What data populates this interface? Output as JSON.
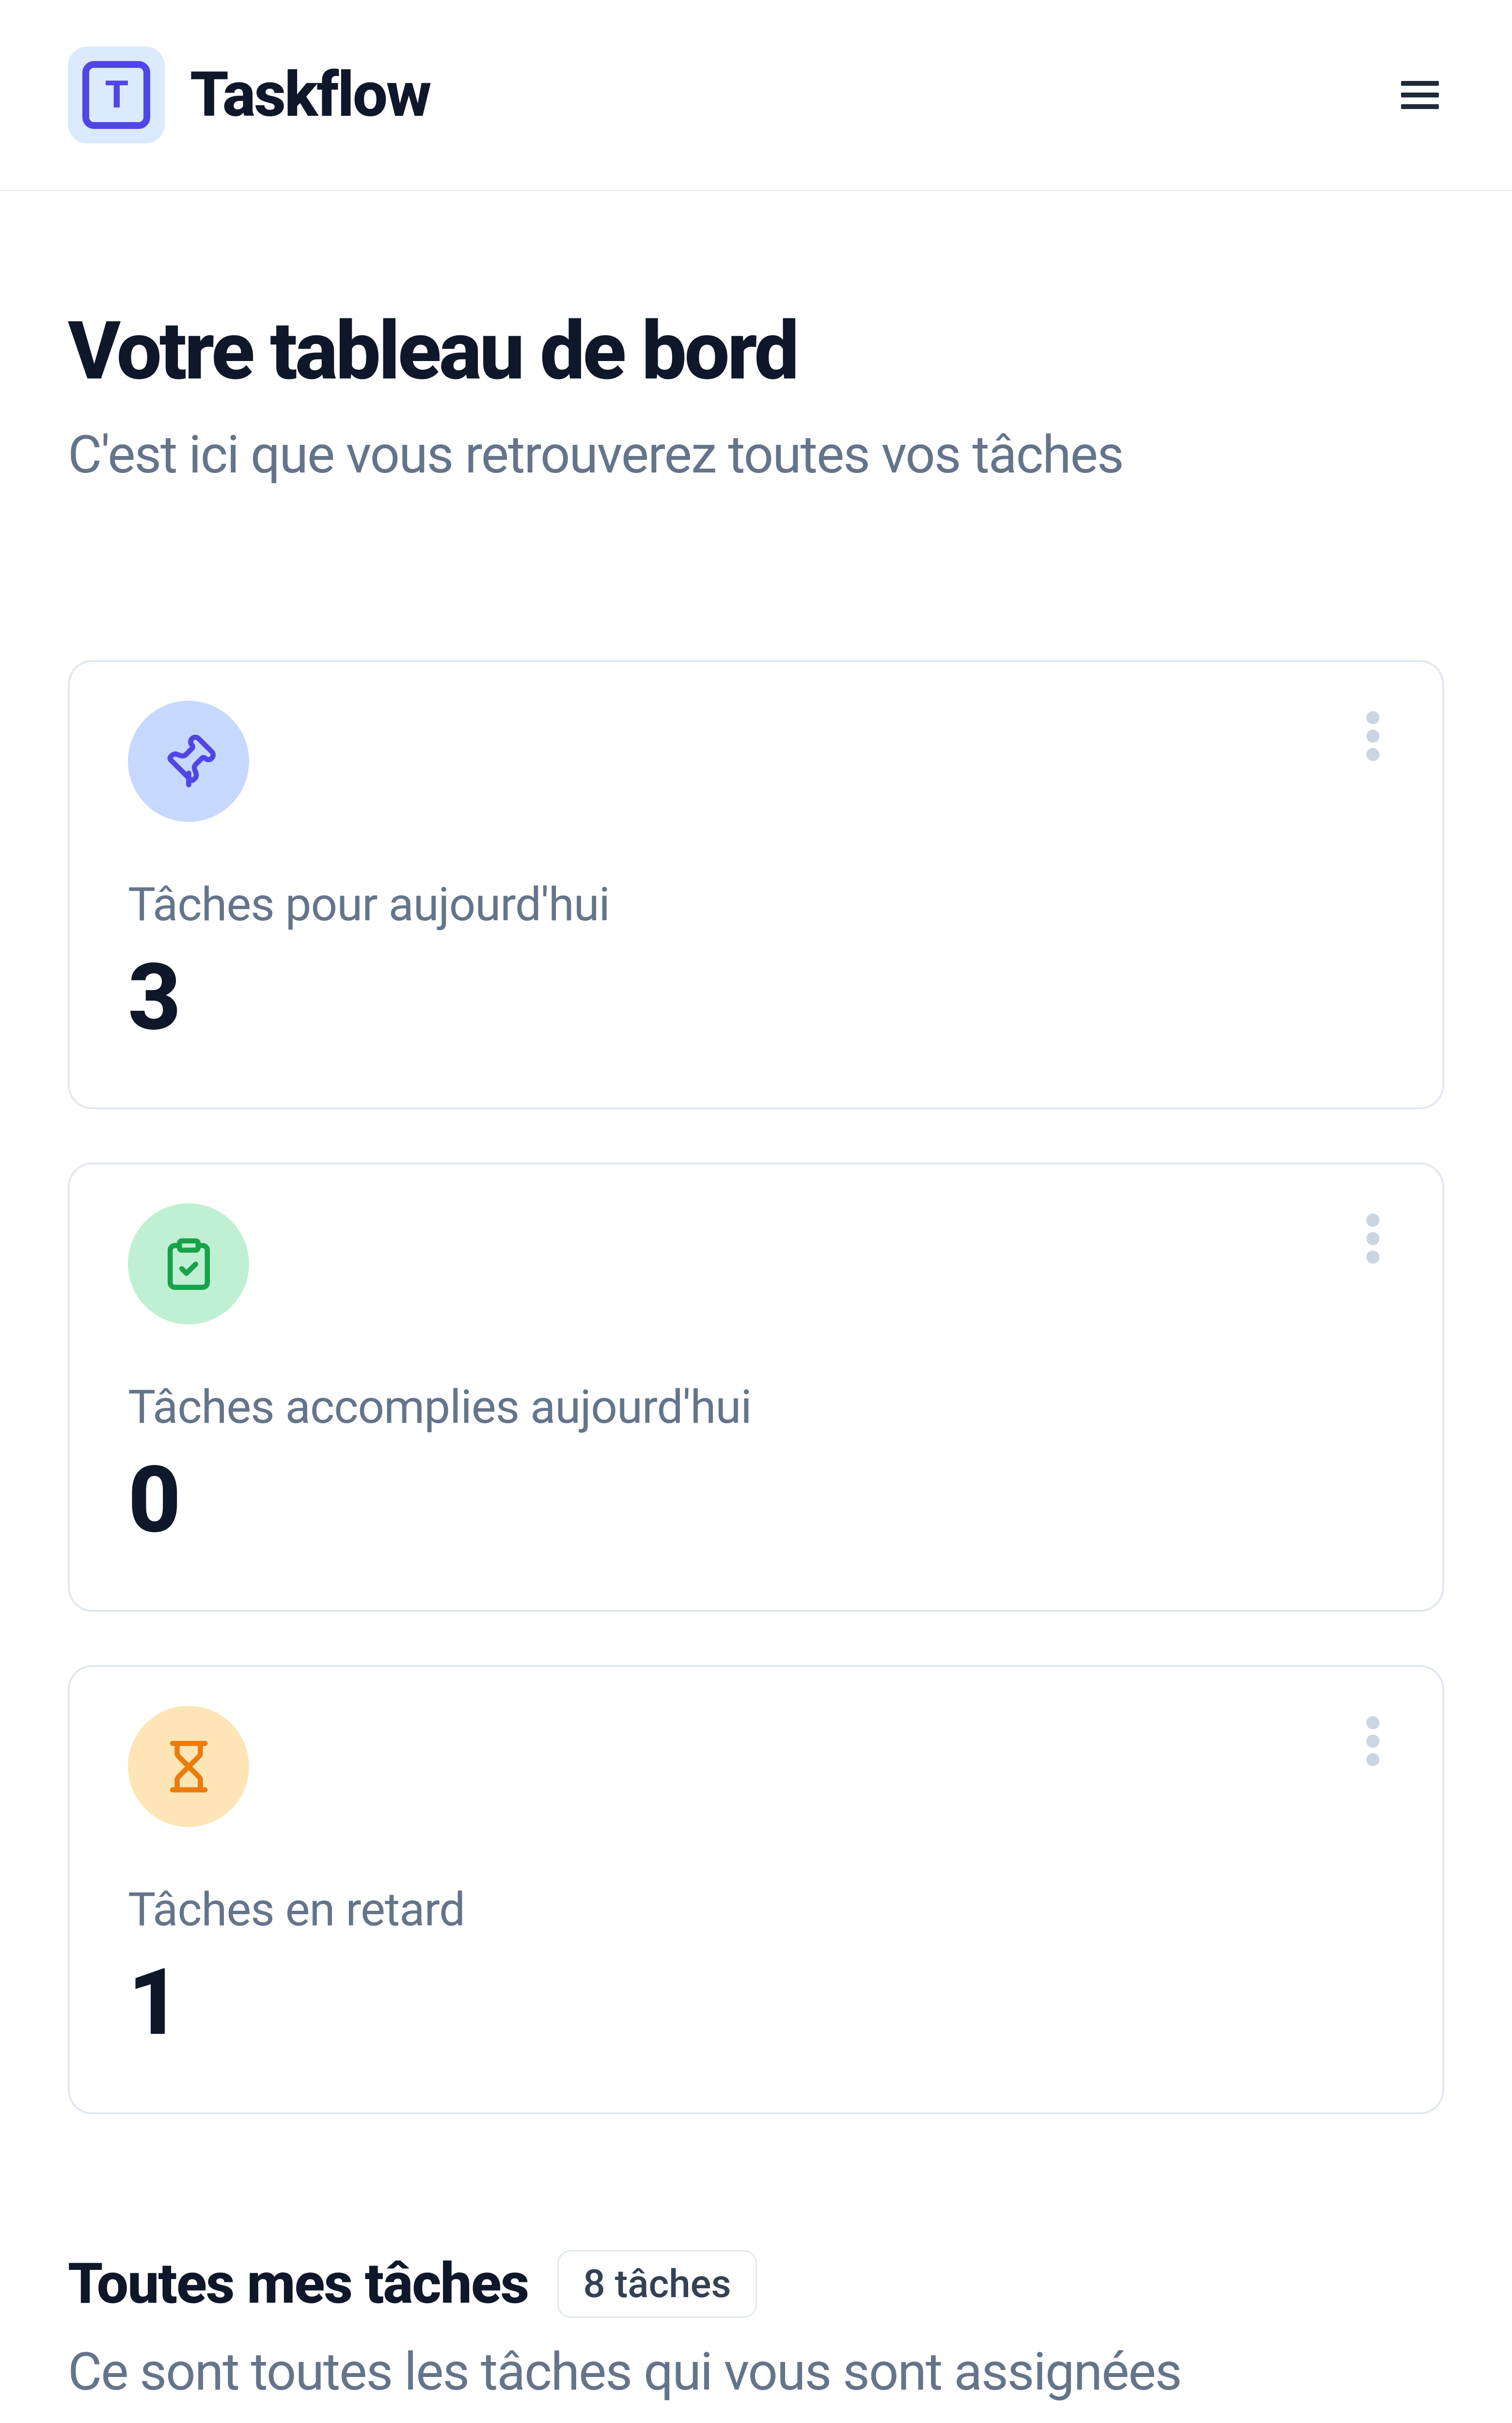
{
  "header": {
    "app_name": "Taskflow",
    "logo_letter": "T"
  },
  "page": {
    "title": "Votre tableau de bord",
    "subtitle": "C'est ici que vous retrouverez toutes vos tâches"
  },
  "stats": [
    {
      "label": "Tâches pour aujourd'hui",
      "value": "3",
      "icon": "pin",
      "color": "blue"
    },
    {
      "label": "Tâches accomplies aujourd'hui",
      "value": "0",
      "icon": "clipboard-check",
      "color": "green"
    },
    {
      "label": "Tâches en retard",
      "value": "1",
      "icon": "hourglass",
      "color": "amber"
    }
  ],
  "tasks_section": {
    "title": "Toutes mes tâches",
    "badge": "8 tâches",
    "subtitle": "Ce sont toutes les tâches qui vous sont assignées"
  }
}
